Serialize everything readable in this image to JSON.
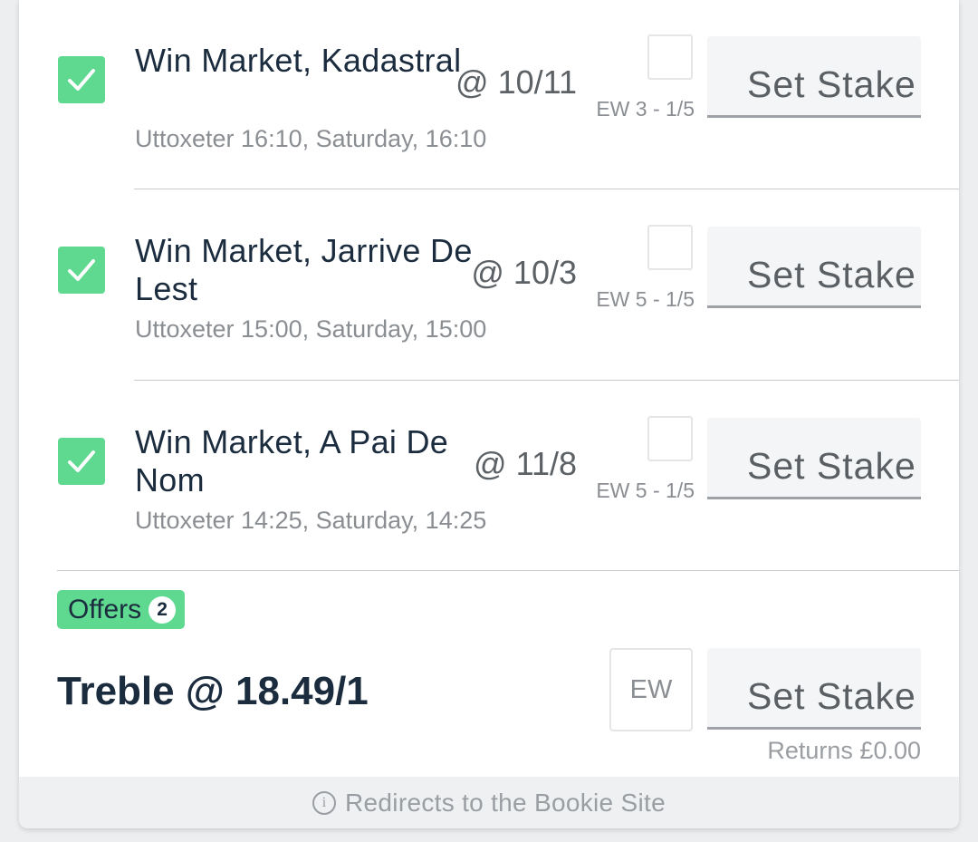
{
  "selections": [
    {
      "name": "Win Market, Kadastral",
      "odds": "@ 10/11",
      "info": "Uttoxeter 16:10, Saturday, 16:10",
      "ew_terms": "EW 3 - 1/5",
      "stake_placeholder": "Set Stake"
    },
    {
      "name": "Win Market, Jarrive De Lest",
      "odds": "@ 10/3",
      "info": "Uttoxeter 15:00, Saturday, 15:00",
      "ew_terms": "EW 5 - 1/5",
      "stake_placeholder": "Set Stake"
    },
    {
      "name": "Win Market, A Pai De Nom",
      "odds": "@ 11/8",
      "info": "Uttoxeter 14:25, Saturday, 14:25",
      "ew_terms": "EW 5 - 1/5",
      "stake_placeholder": "Set Stake"
    }
  ],
  "offers": {
    "label": "Offers",
    "count": "2"
  },
  "treble": {
    "label": "Treble @ 18.49/1",
    "ew_label": "EW",
    "stake_placeholder": "Set Stake",
    "returns": "Returns £0.00"
  },
  "footer": {
    "text": "Redirects to the Bookie Site"
  },
  "colors": {
    "accent_green": "#5fd890",
    "text_dark": "#1b2c3e"
  }
}
